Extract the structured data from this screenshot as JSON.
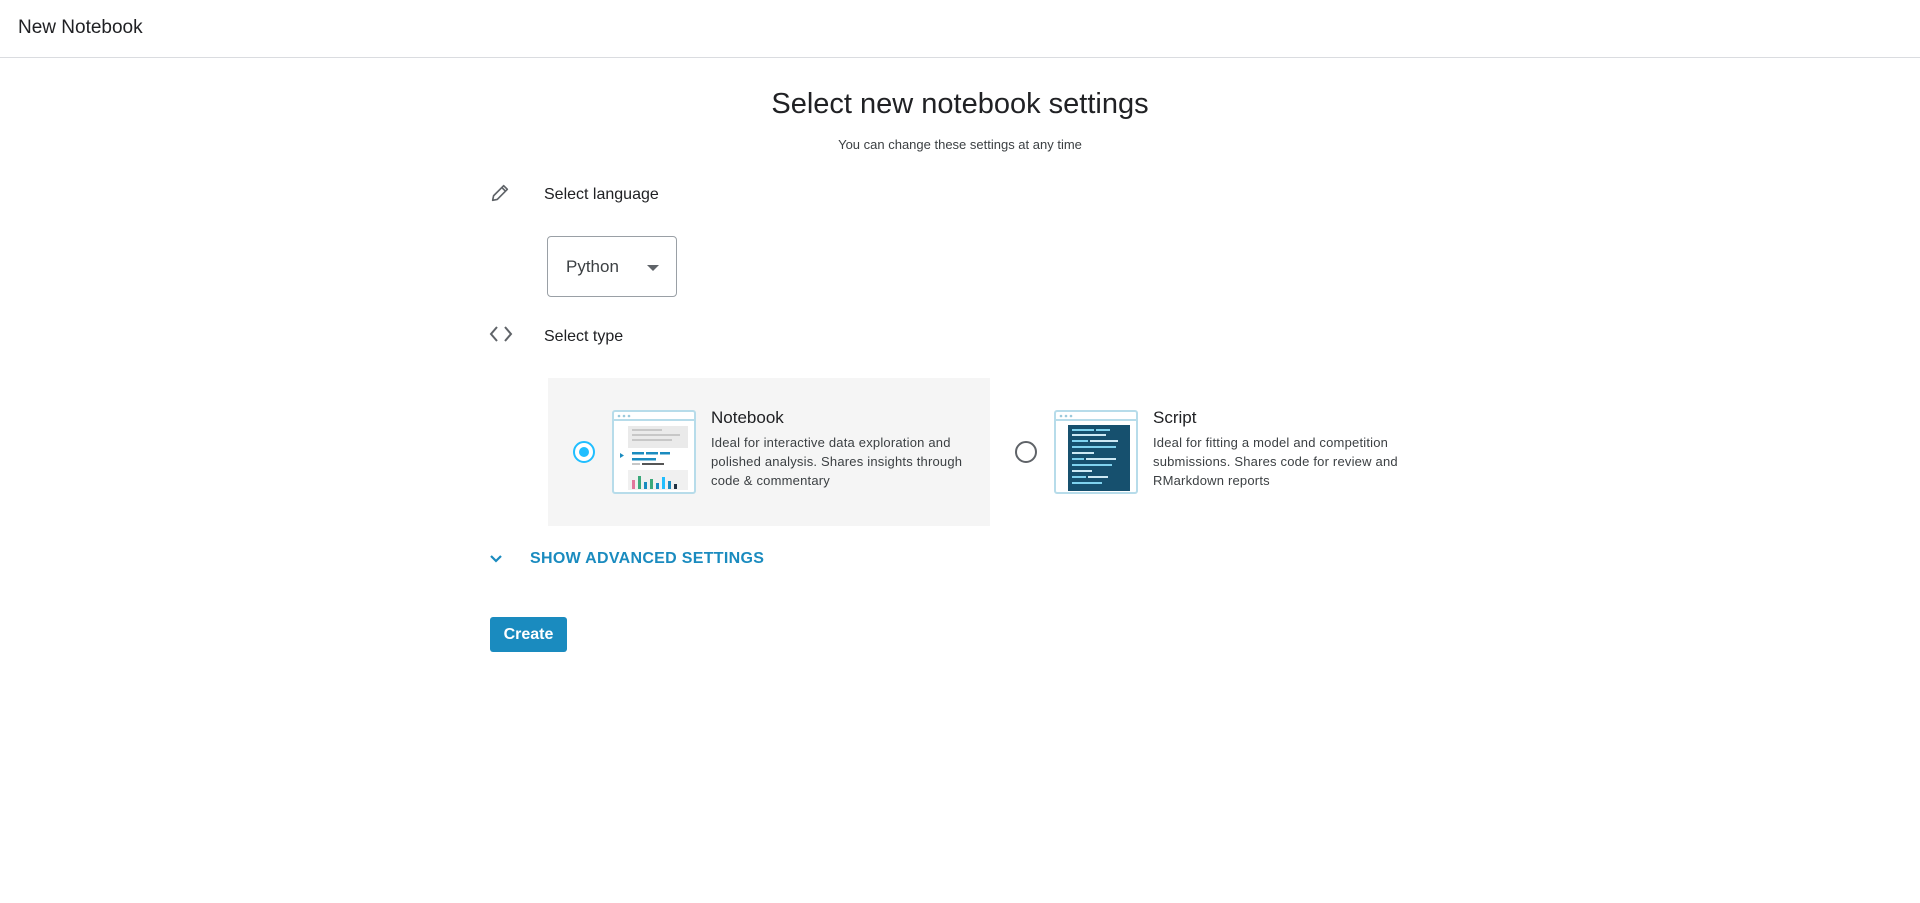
{
  "header": {
    "title": "New Notebook"
  },
  "main": {
    "heading": "Select new notebook settings",
    "subheading": "You can change these settings at any time",
    "language": {
      "icon": "pencil-icon",
      "label": "Select language",
      "selected": "Python"
    },
    "type": {
      "icon": "code-brackets-icon",
      "label": "Select type",
      "options": [
        {
          "title": "Notebook",
          "description": "Ideal for interactive data exploration and polished analysis. Shares insights through code & commentary",
          "selected": true
        },
        {
          "title": "Script",
          "description": "Ideal for fitting a model and competition submissions. Shares code for review and RMarkdown reports",
          "selected": false
        }
      ]
    },
    "advanced": {
      "icon": "chevron-down-icon",
      "label": "SHOW ADVANCED SETTINGS"
    },
    "create_label": "Create"
  },
  "colors": {
    "accent": "#1a8bbf",
    "radio_selected": "#20beff",
    "card_selected_bg": "#f5f5f5",
    "text_primary": "#202124"
  }
}
